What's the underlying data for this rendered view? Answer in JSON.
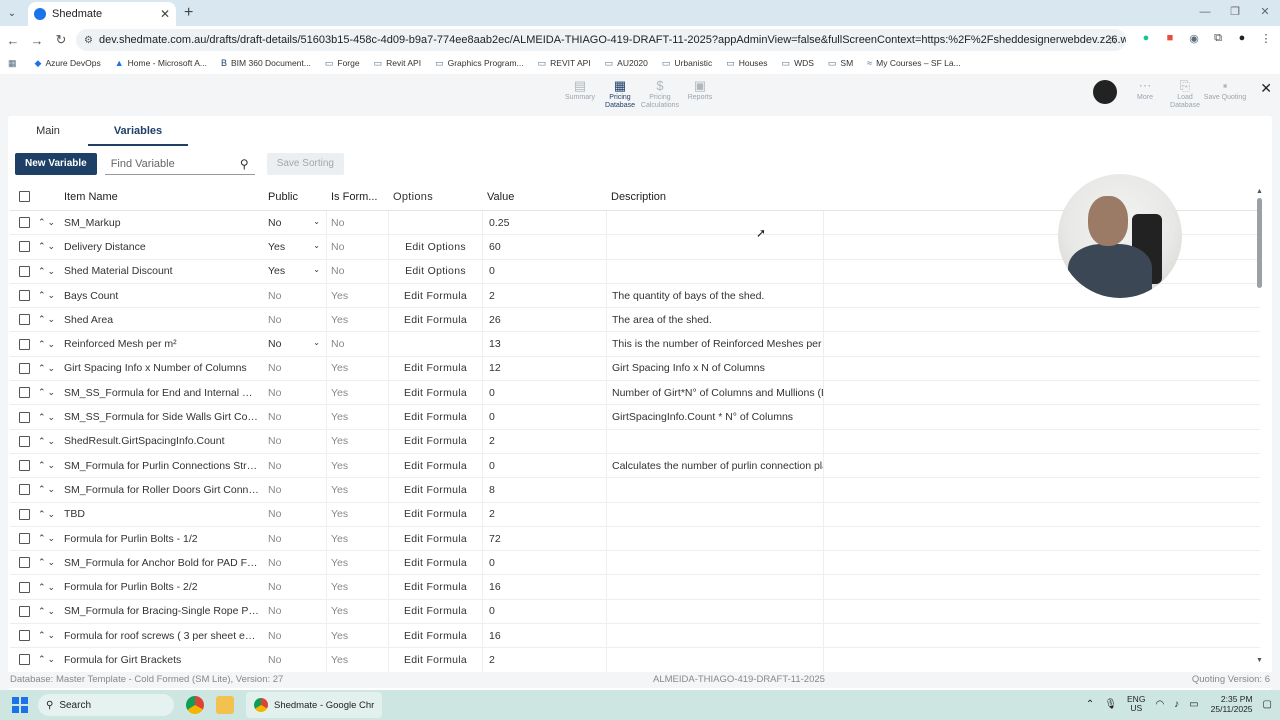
{
  "browser": {
    "tab_title": "Shedmate",
    "url": "dev.shedmate.com.au/drafts/draft-details/51603b15-458c-4d09-b9a7-774ee8aab2ec/ALMEIDA-THIAGO-419-DRAFT-11-2025?appAdminView=false&fullScreenContext=https:%2F%2Fsheddesignerwebdev.z26.web.core.windows.net%2Finstant-quoting&comp...",
    "bookmarks": [
      "Azure DevOps",
      "Home - Microsoft A...",
      "BIM 360 Document...",
      "Forge",
      "Revit API",
      "Graphics Program...",
      "REVIT API",
      "AU2020",
      "Urbanistic",
      "Houses",
      "WDS",
      "SM",
      "My Courses – SF La..."
    ]
  },
  "toolbar": {
    "items": [
      "Summary",
      "Pricing Database",
      "Pricing Calculations",
      "Reports"
    ],
    "right": [
      "More",
      "Load Database",
      "Save Quoting"
    ]
  },
  "tabs": [
    "Main",
    "Variables"
  ],
  "actions": {
    "new_variable": "New Variable",
    "search_placeholder": "Find Variable",
    "save_sorting": "Save Sorting"
  },
  "columns": [
    "Item Name",
    "Public",
    "Is Form...",
    "Options",
    "Value",
    "Description"
  ],
  "rows": [
    {
      "name": "SM_Markup",
      "public": "No",
      "public_dd": true,
      "formula": "No",
      "options": "",
      "value": "0.25",
      "desc": ""
    },
    {
      "name": "Delivery Distance",
      "public": "Yes",
      "public_dd": true,
      "formula": "No",
      "options": "Edit Options",
      "value": "60",
      "desc": ""
    },
    {
      "name": "Shed Material Discount",
      "public": "Yes",
      "public_dd": true,
      "formula": "No",
      "options": "Edit Options",
      "value": "0",
      "desc": ""
    },
    {
      "name": "Bays Count",
      "public": "No",
      "public_dd": false,
      "formula": "Yes",
      "options": "Edit Formula",
      "value": "2",
      "desc": "The quantity of bays of the shed."
    },
    {
      "name": "Shed Area",
      "public": "No",
      "public_dd": false,
      "formula": "Yes",
      "options": "Edit Formula",
      "value": "26",
      "desc": "The area of the shed."
    },
    {
      "name": "Reinforced Mesh per m²",
      "public": "No",
      "public_dd": true,
      "formula": "No",
      "options": "",
      "value": "13",
      "desc": "This is the number of Reinforced Meshes per ..."
    },
    {
      "name": "Girt Spacing Info x Number of Columns",
      "public": "No",
      "public_dd": false,
      "formula": "Yes",
      "options": "Edit Formula",
      "value": "12",
      "desc": "Girt Spacing Info x N of Columns"
    },
    {
      "name": "SM_SS_Formula for End and Internal Walls...",
      "public": "No",
      "public_dd": false,
      "formula": "Yes",
      "options": "Edit Formula",
      "value": "0",
      "desc": "Number of Girt*N° of Columns and Mullions (D..."
    },
    {
      "name": "SM_SS_Formula for Side Walls Girt Conne...",
      "public": "No",
      "public_dd": false,
      "formula": "Yes",
      "options": "Edit Formula",
      "value": "0",
      "desc": "GirtSpacingInfo.Count * N° of Columns"
    },
    {
      "name": "ShedResult.GirtSpacingInfo.Count",
      "public": "No",
      "public_dd": false,
      "formula": "Yes",
      "options": "Edit Formula",
      "value": "2",
      "desc": ""
    },
    {
      "name": "SM_Formula for Purlin Connections Struct...",
      "public": "No",
      "public_dd": false,
      "formula": "Yes",
      "options": "Edit Formula",
      "value": "0",
      "desc": "Calculates the number of purlin connection pla..."
    },
    {
      "name": "SM_Formula for Roller Doors Girt Connecti...",
      "public": "No",
      "public_dd": false,
      "formula": "Yes",
      "options": "Edit Formula",
      "value": "8",
      "desc": ""
    },
    {
      "name": "TBD",
      "public": "No",
      "public_dd": false,
      "formula": "Yes",
      "options": "Edit Formula",
      "value": "2",
      "desc": ""
    },
    {
      "name": "Formula for Purlin Bolts - 1/2",
      "public": "No",
      "public_dd": false,
      "formula": "Yes",
      "options": "Edit Formula",
      "value": "72",
      "desc": ""
    },
    {
      "name": "SM_Formula for Anchor Bold for PAD Footi...",
      "public": "No",
      "public_dd": false,
      "formula": "Yes",
      "options": "Edit Formula",
      "value": "0",
      "desc": ""
    },
    {
      "name": "Formula for Purlin Bolts - 2/2",
      "public": "No",
      "public_dd": false,
      "formula": "Yes",
      "options": "Edit Formula",
      "value": "16",
      "desc": ""
    },
    {
      "name": "SM_Formula for Bracing-Single Rope Plates",
      "public": "No",
      "public_dd": false,
      "formula": "Yes",
      "options": "Edit Formula",
      "value": "0",
      "desc": ""
    },
    {
      "name": "Formula for roof screws ( 3 per sheet ever...",
      "public": "No",
      "public_dd": false,
      "formula": "Yes",
      "options": "Edit Formula",
      "value": "16",
      "desc": ""
    },
    {
      "name": "Formula for Girt Brackets",
      "public": "No",
      "public_dd": false,
      "formula": "Yes",
      "options": "Edit Formula",
      "value": "2",
      "desc": ""
    }
  ],
  "status": {
    "left": "Database: Master Template - Cold Formed (SM Lite), Version: 27",
    "middle": "ALMEIDA-THIAGO-419-DRAFT-11-2025",
    "right": "Quoting Version: 6"
  },
  "taskbar": {
    "search": "Search",
    "active_app": "Shedmate - Google Chr",
    "lang_top": "ENG",
    "lang_bottom": "US",
    "time": "2:35 PM",
    "date": "25/11/2025"
  }
}
